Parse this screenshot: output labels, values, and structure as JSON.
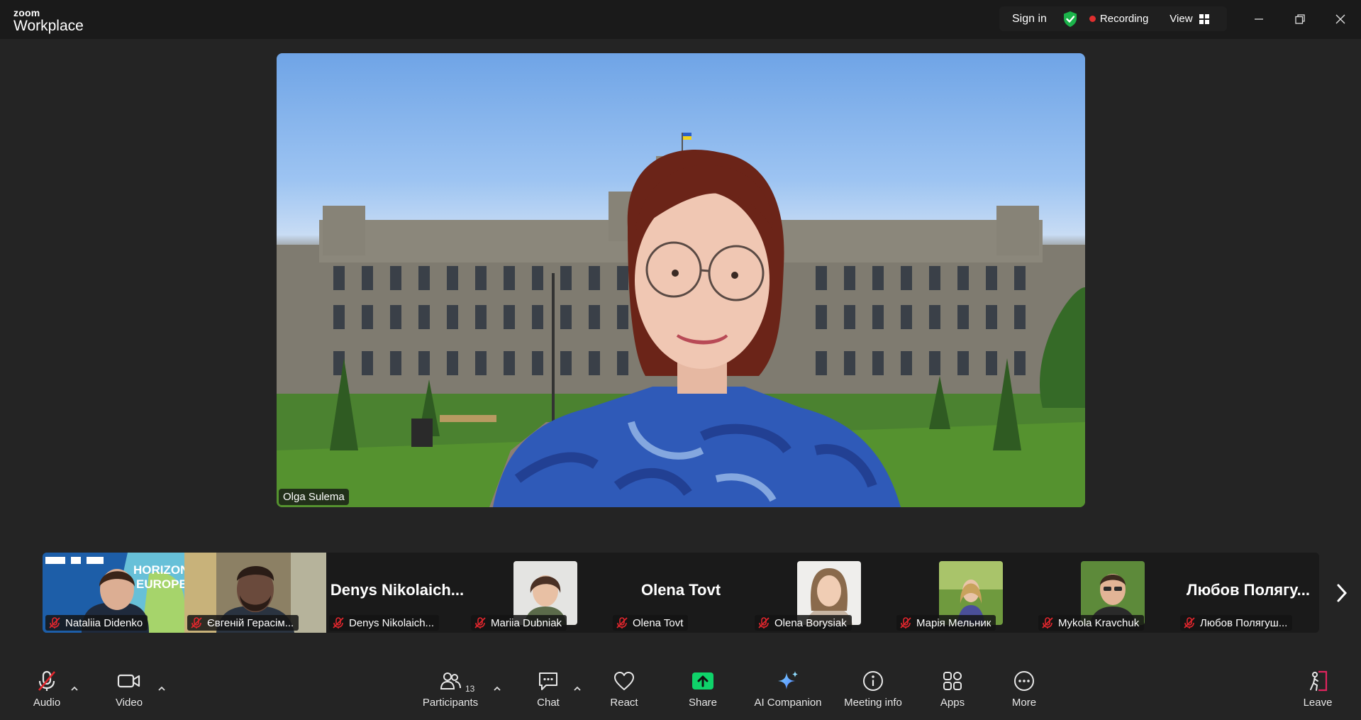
{
  "window": {
    "brand_top": "zoom",
    "brand_bottom": "Workplace",
    "sign_in": "Sign in",
    "recording": "Recording",
    "view": "View"
  },
  "main_video": {
    "speaker_name": "Olga Sulema"
  },
  "participants": [
    {
      "name": "Nataliia Didenko",
      "display": "video",
      "muted": true
    },
    {
      "name": "Євгеній Герасім...",
      "display": "video",
      "muted": true
    },
    {
      "name": "Denys Nikolaich...",
      "big_name": "Denys  Nikolaich...",
      "display": "name",
      "muted": true
    },
    {
      "name": "Mariia Dubniak",
      "display": "photo",
      "muted": true
    },
    {
      "name": "Olena Tovt",
      "big_name": "Olena Tovt",
      "display": "name",
      "muted": true
    },
    {
      "name": "Olena Borysiak",
      "display": "photo",
      "muted": true
    },
    {
      "name": "Марія Мельник",
      "display": "photo",
      "muted": true
    },
    {
      "name": "Mykola Kravchuk",
      "display": "photo",
      "muted": true
    },
    {
      "name": "Любов Полягуш...",
      "big_name": "Любов  Полягу...",
      "display": "name",
      "muted": true
    }
  ],
  "toolbar": {
    "audio": "Audio",
    "video": "Video",
    "participants": "Participants",
    "participants_count": "13",
    "chat": "Chat",
    "react": "React",
    "share": "Share",
    "ai_companion": "AI Companion",
    "meeting_info": "Meeting info",
    "apps": "Apps",
    "more": "More",
    "leave": "Leave"
  },
  "colors": {
    "share_green": "#0fd36a",
    "recording_red": "#e02f2f",
    "mute_red": "#e0262d",
    "leave_pink": "#e0245e"
  }
}
